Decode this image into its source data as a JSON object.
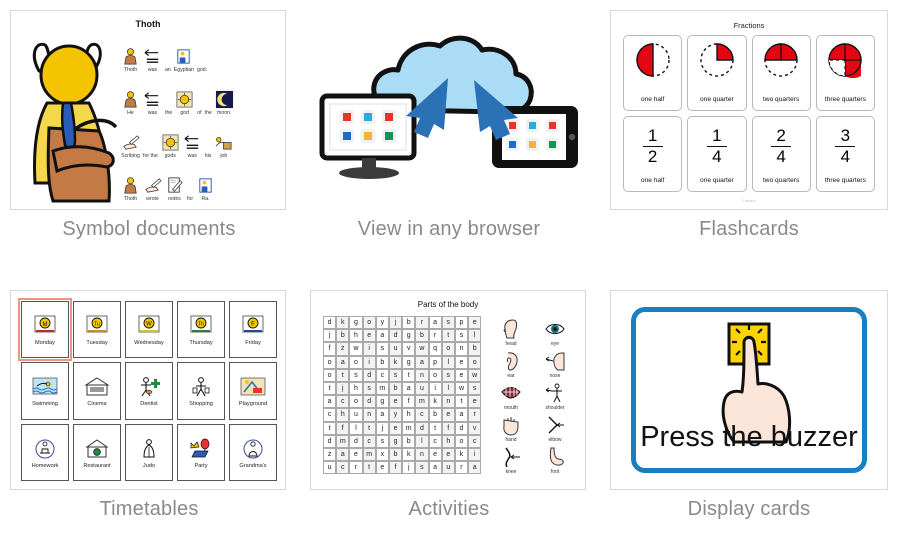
{
  "gallery": {
    "items": [
      {
        "id": "symbol-documents",
        "caption": "Symbol documents",
        "doc": {
          "title": "Thoth",
          "lines": [
            {
              "words": [
                {
                  "text": "Thoth",
                  "icon": "thoth-figure-icon"
                },
                {
                  "text": "was",
                  "icon": "equals-arrow-icon"
                },
                {
                  "text": "an",
                  "icon": "blank-icon"
                },
                {
                  "text": "Egyptian",
                  "icon": "egyptian-person-icon"
                },
                {
                  "text": "god.",
                  "icon": "blank-icon"
                }
              ]
            },
            {
              "words": [
                {
                  "text": "He",
                  "icon": "thoth-figure-icon"
                },
                {
                  "text": "was",
                  "icon": "equals-arrow-icon"
                },
                {
                  "text": "the",
                  "icon": "blank-icon"
                },
                {
                  "text": "god",
                  "icon": "sun-god-icon"
                },
                {
                  "text": "of",
                  "icon": "blank-icon"
                },
                {
                  "text": "the",
                  "icon": "blank-icon"
                },
                {
                  "text": "moon.",
                  "icon": "moon-icon"
                }
              ]
            },
            {
              "words": [
                {
                  "text": "Scribing",
                  "icon": "writing-hand-icon"
                },
                {
                  "text": "for the",
                  "icon": "blank-icon"
                },
                {
                  "text": "gods",
                  "icon": "sun-god-icon"
                },
                {
                  "text": "was",
                  "icon": "equals-arrow-icon"
                },
                {
                  "text": "his",
                  "icon": "blank-icon"
                },
                {
                  "text": "job",
                  "icon": "work-icon"
                }
              ]
            },
            {
              "words": [
                {
                  "text": "Thoth",
                  "icon": "thoth-figure-icon"
                },
                {
                  "text": "wrote",
                  "icon": "writing-hand-icon"
                },
                {
                  "text": "notes",
                  "icon": "notes-page-icon"
                },
                {
                  "text": "for",
                  "icon": "blank-icon"
                },
                {
                  "text": "Ra.",
                  "icon": "egyptian-person-icon"
                }
              ]
            }
          ]
        }
      },
      {
        "id": "view-in-any-browser",
        "caption": "View in any browser",
        "art": {
          "cloud_color": "#aadcf5",
          "arrow_color": "#2a72b5",
          "tile_colors": [
            "#e8342c",
            "#2fa8e0",
            "#e8342c",
            "#1a6fc4",
            "#f5b335",
            "#169354"
          ]
        }
      },
      {
        "id": "flashcards",
        "caption": "Flashcards",
        "doc": {
          "title": "Fractions",
          "footer": "Fraction",
          "fill_color": "#e30613",
          "cards": [
            {
              "label": "one half",
              "type": "pie",
              "filled": 2,
              "of": 4,
              "mode": "half"
            },
            {
              "label": "one quarter",
              "type": "pie",
              "filled": 1,
              "of": 4,
              "mode": "quarter"
            },
            {
              "label": "two quarters",
              "type": "pie",
              "filled": 2,
              "of": 4,
              "mode": "two-quarters"
            },
            {
              "label": "three quarters",
              "type": "pie",
              "filled": 3,
              "of": 4,
              "mode": "three-quarters"
            },
            {
              "label": "one half",
              "type": "frac",
              "numerator": "1",
              "denominator": "2"
            },
            {
              "label": "one quarter",
              "type": "frac",
              "numerator": "1",
              "denominator": "4"
            },
            {
              "label": "two quarters",
              "type": "frac",
              "numerator": "2",
              "denominator": "4"
            },
            {
              "label": "three quarters",
              "type": "frac",
              "numerator": "3",
              "denominator": "4"
            }
          ]
        }
      },
      {
        "id": "timetables",
        "caption": "Timetables",
        "doc": {
          "selected_index": 0,
          "selection_color": "#e8997b",
          "cells": [
            {
              "label": "Monday",
              "icon": "sun-monday-icon",
              "letter": "M"
            },
            {
              "label": "Tuesday",
              "icon": "sun-tuesday-icon",
              "letter": "Tu"
            },
            {
              "label": "Wednesday",
              "icon": "sun-wednesday-icon",
              "letter": "W"
            },
            {
              "label": "Thursday",
              "icon": "sun-thursday-icon",
              "letter": "Th"
            },
            {
              "label": "Friday",
              "icon": "sun-friday-icon",
              "letter": "F"
            },
            {
              "label": "Swimming",
              "icon": "swimming-icon"
            },
            {
              "label": "Cinema",
              "icon": "cinema-icon"
            },
            {
              "label": "Dentist",
              "icon": "dentist-icon"
            },
            {
              "label": "Shopping",
              "icon": "shopping-icon"
            },
            {
              "label": "Playground",
              "icon": "playground-icon"
            },
            {
              "label": "Homework",
              "icon": "homework-icon"
            },
            {
              "label": "Restaurant",
              "icon": "restaurant-icon"
            },
            {
              "label": "Judo",
              "icon": "judo-icon"
            },
            {
              "label": "Party",
              "icon": "party-icon"
            },
            {
              "label": "Grandma's",
              "icon": "grandmas-icon"
            }
          ]
        }
      },
      {
        "id": "activities",
        "caption": "Activities",
        "doc": {
          "title": "Parts of the body",
          "grid": [
            [
              "d",
              "k",
              "g",
              "o",
              "y",
              "j",
              "b",
              "r",
              "a",
              "s",
              "p",
              "e"
            ],
            [
              "j",
              "b",
              "h",
              "e",
              "a",
              "d",
              "g",
              "b",
              "r",
              "t",
              "s",
              "l"
            ],
            [
              "f",
              "z",
              "w",
              "i",
              "s",
              "u",
              "v",
              "w",
              "q",
              "o",
              "n",
              "b"
            ],
            [
              "o",
              "a",
              "o",
              "i",
              "b",
              "k",
              "g",
              "a",
              "p",
              "l",
              "e",
              "o"
            ],
            [
              "o",
              "t",
              "s",
              "d",
              "c",
              "s",
              "t",
              "n",
              "o",
              "s",
              "e",
              "w"
            ],
            [
              "t",
              "j",
              "h",
              "s",
              "m",
              "b",
              "a",
              "u",
              "i",
              "l",
              "w",
              "s"
            ],
            [
              "a",
              "c",
              "o",
              "d",
              "g",
              "e",
              "f",
              "m",
              "k",
              "n",
              "t",
              "e"
            ],
            [
              "c",
              "h",
              "u",
              "n",
              "a",
              "y",
              "h",
              "c",
              "b",
              "e",
              "a",
              "r"
            ],
            [
              "t",
              "f",
              "l",
              "t",
              "j",
              "e",
              "m",
              "d",
              "t",
              "f",
              "d",
              "v"
            ],
            [
              "d",
              "m",
              "d",
              "c",
              "s",
              "g",
              "b",
              "l",
              "c",
              "h",
              "o",
              "c"
            ],
            [
              "z",
              "a",
              "e",
              "m",
              "x",
              "b",
              "k",
              "n",
              "e",
              "e",
              "k",
              "i"
            ],
            [
              "u",
              "c",
              "r",
              "t",
              "e",
              "f",
              "j",
              "s",
              "a",
              "u",
              "r",
              "a"
            ]
          ],
          "words": [
            {
              "label": "head",
              "icon": "head-icon"
            },
            {
              "label": "eye",
              "icon": "eye-icon"
            },
            {
              "label": "ear",
              "icon": "ear-icon"
            },
            {
              "label": "nose",
              "icon": "nose-icon"
            },
            {
              "label": "mouth",
              "icon": "mouth-icon"
            },
            {
              "label": "shoulder",
              "icon": "shoulder-icon"
            },
            {
              "label": "hand",
              "icon": "hand-icon"
            },
            {
              "label": "elbow",
              "icon": "elbow-icon"
            },
            {
              "label": "knee",
              "icon": "knee-icon"
            },
            {
              "label": "foot",
              "icon": "foot-icon"
            }
          ]
        }
      },
      {
        "id": "display-cards",
        "caption": "Display cards",
        "doc": {
          "text": "Press the buzzer",
          "border_color": "#1a7fc1",
          "button_color": "#ffd400",
          "icon": "press-buzzer-icon"
        }
      }
    ]
  }
}
